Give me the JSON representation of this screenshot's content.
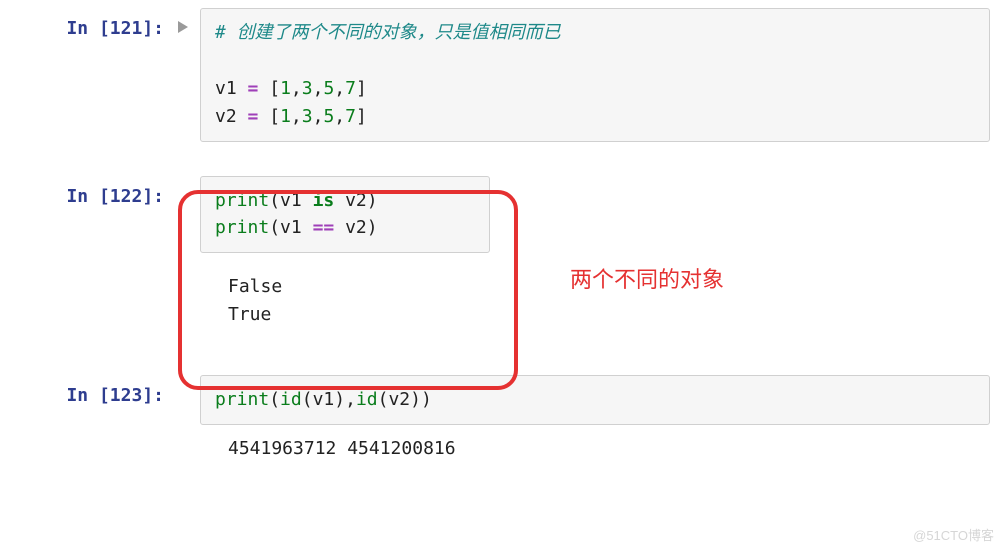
{
  "cells": {
    "c121": {
      "prompt_prefix": "In ",
      "prompt_num": "121",
      "comment": "# 创建了两个不同的对象，只是值相同而已",
      "line2_var": "v1",
      "line2_op": "=",
      "line2_open": "[",
      "line2_n0": "1",
      "line2_n1": "3",
      "line2_n2": "5",
      "line2_n3": "7",
      "line2_close": "]",
      "line3_var": "v2",
      "line3_op": "=",
      "line3_open": "[",
      "line3_n0": "1",
      "line3_n1": "3",
      "line3_n2": "5",
      "line3_n3": "7",
      "line3_close": "]"
    },
    "c122": {
      "prompt_prefix": "In ",
      "prompt_num": "122",
      "l1_fn": "print",
      "l1_open": "(",
      "l1_a": "v1",
      "l1_kw": "is",
      "l1_b": "v2",
      "l1_close": ")",
      "l2_fn": "print",
      "l2_open": "(",
      "l2_a": "v1",
      "l2_op": "==",
      "l2_b": "v2",
      "l2_close": ")",
      "out1": "False",
      "out2": "True"
    },
    "c123": {
      "prompt_prefix": "In ",
      "prompt_num": "123",
      "l1_fn": "print",
      "l1_open": "(",
      "l1_id1": "id",
      "l1_po1": "(",
      "l1_a1": "v1",
      "l1_pc1": ")",
      "l1_comma": ",",
      "l1_id2": "id",
      "l1_po2": "(",
      "l1_a2": "v2",
      "l1_pc2": ")",
      "l1_close": ")",
      "out": "4541963712 4541200816"
    }
  },
  "annotation": "两个不同的对象",
  "watermark": "@51CTO博客",
  "chart_data": {
    "type": "table",
    "title": "Jupyter notebook cells demonstrating Python object identity vs equality",
    "cells": [
      {
        "prompt": "In [121]:",
        "input": "# 创建了两个不同的对象，只是值相同而已\n\nv1 = [1,3,5,7]\nv2 = [1,3,5,7]",
        "output": ""
      },
      {
        "prompt": "In [122]:",
        "input": "print(v1 is v2)\nprint(v1 == v2)",
        "output": "False\nTrue"
      },
      {
        "prompt": "In [123]:",
        "input": "print(id(v1),id(v2))",
        "output": "4541963712 4541200816"
      }
    ],
    "annotation": "两个不同的对象",
    "highlight": "Cell 122 (input + output) boxed in red"
  }
}
